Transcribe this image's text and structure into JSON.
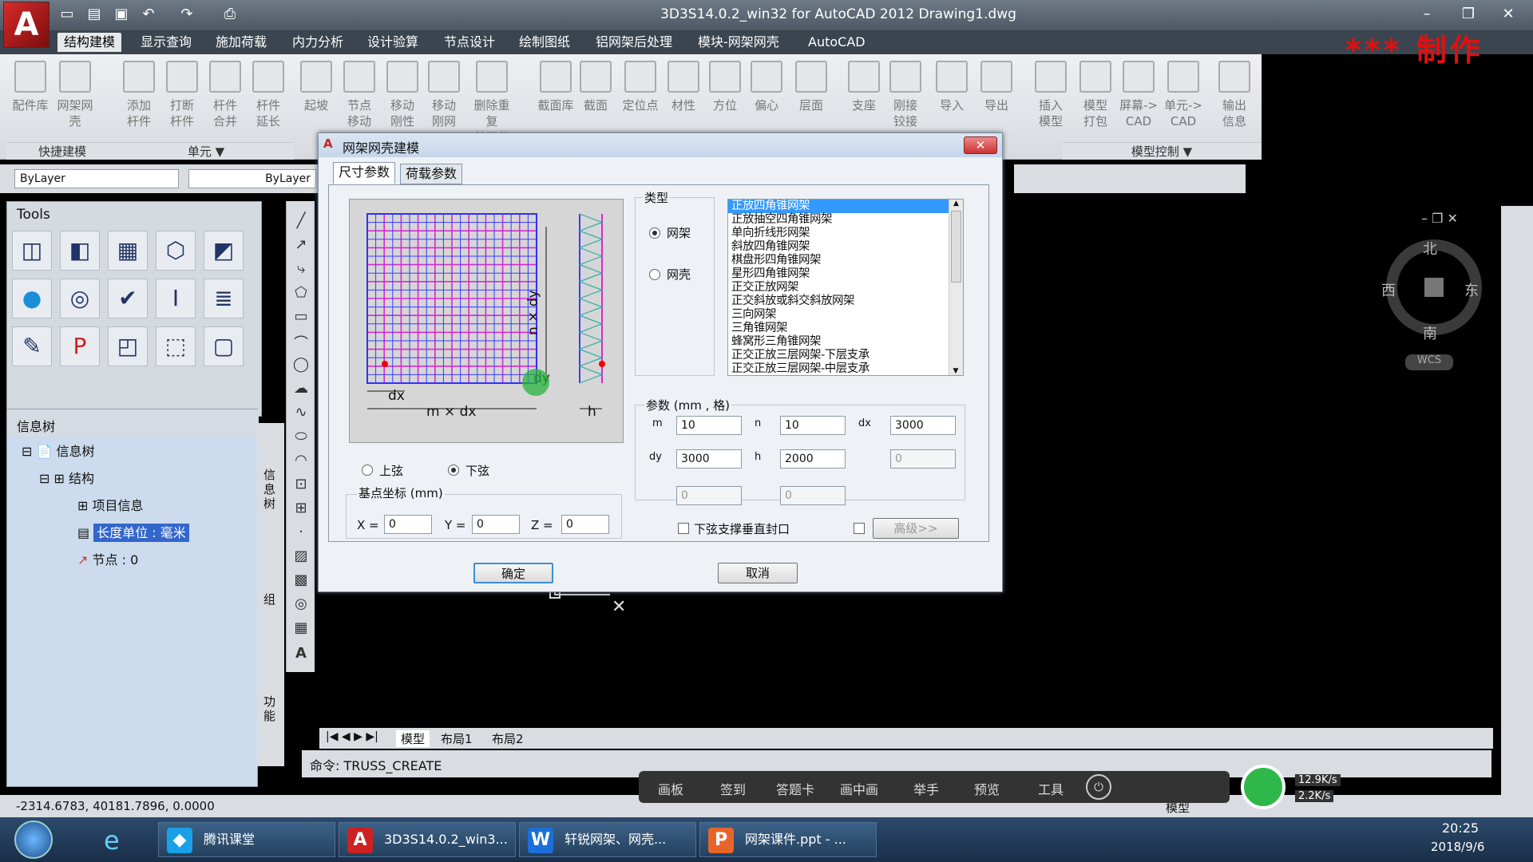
{
  "window": {
    "title": "3D3S14.0.2_win32 for AutoCAD 2012    Drawing1.dwg",
    "maker_text": "*** 制作"
  },
  "menu": [
    "结构建模",
    "显示查询",
    "施加荷载",
    "内力分析",
    "设计验算",
    "节点设计",
    "绘制图纸",
    "铝网架后处理",
    "模块-网架网壳",
    "AutoCAD"
  ],
  "ribbon": {
    "buttons": [
      "配件库",
      "网架网壳",
      "添加\n杆件",
      "打断\n杆件",
      "杆件\n合并",
      "杆件\n延长",
      "起坡",
      "节点\n移动",
      "移动\n刚性",
      "移动\n刚网",
      "删除重复\n单元节点",
      "截面库",
      "截面",
      "定位点",
      "材性",
      "方位",
      "偏心",
      "层面",
      "支座",
      "刚接\n铰接",
      "导入",
      "导出",
      "插入\n模型",
      "模型\n打包",
      "屏幕->\nCAD",
      "单元->\nCAD",
      "输出\n信息"
    ],
    "groups": [
      "快捷建模",
      "单元 ▼",
      "模型控制 ▼"
    ]
  },
  "layer": {
    "combo1": "ByLayer",
    "combo2": "ByLayer"
  },
  "tools_title": "Tools",
  "info_panel": {
    "title": "信息树",
    "tree": [
      "信息树",
      "结构",
      "项目信息",
      "长度单位 : 毫米",
      "节点 :  0"
    ]
  },
  "side_tabs": [
    "信息树",
    "组",
    "功能"
  ],
  "compass": {
    "n": "北",
    "s": "南",
    "e": "东",
    "w": "西",
    "wcs": "WCS"
  },
  "layout_tabs": [
    "模型",
    "布局1",
    "布局2"
  ],
  "command": "命令:  TRUSS_CREATE",
  "status": {
    "coords": "-2314.6783,   40181.7896,  0.0000",
    "mode": "模型"
  },
  "popbar": [
    "画板",
    "签到",
    "答题卡",
    "画中画",
    "举手",
    "预览",
    "工具"
  ],
  "net": {
    "up": "12.9K/s",
    "down": "2.2K/s"
  },
  "taskbar": {
    "tasks": [
      "腾讯课堂",
      "3D3S14.0.2_win3...",
      "轩锐网架、网壳...",
      "网架课件.ppt - ..."
    ],
    "time": "20:25",
    "date": "2018/9/6"
  },
  "dialog": {
    "title": "网架网壳建模",
    "tabs": [
      "尺寸参数",
      "荷载参数"
    ],
    "preview_labels": {
      "ndy": "n × dy",
      "dy": "dy",
      "dx": "dx",
      "mdx": "m × dx",
      "h": "h"
    },
    "chord": {
      "top": "上弦",
      "bottom": "下弦"
    },
    "base_title": "基点坐标 (mm)",
    "base": {
      "x_label": "X =",
      "x": "0",
      "y_label": "Y =",
      "y": "0",
      "z_label": "Z =",
      "z": "0"
    },
    "type_title": "类型",
    "type_options": [
      "网架",
      "网壳"
    ],
    "type_list": [
      "正放四角锥网架",
      "正放抽空四角锥网架",
      "单向折线形网架",
      "斜放四角锥网架",
      "棋盘形四角锥网架",
      "星形四角锥网架",
      "正交正放网架",
      "正交斜放或斜交斜放网架",
      "三向网架",
      "三角锥网架",
      "蜂窝形三角锥网架",
      "正交正放三层网架-下层支承",
      "正交正放三层网架-中层支承"
    ],
    "params_title": "参数 (mm , 格)",
    "params": {
      "m_label": "m",
      "m": "10",
      "n_label": "n",
      "n": "10",
      "dx_label": "dx",
      "dx": "3000",
      "dy_label": "dy",
      "dy": "3000",
      "h_label": "h",
      "h": "2000",
      "extra1": "0",
      "extra2": "0",
      "extra3": "0"
    },
    "checkbox_label": "下弦支撑垂直封口",
    "advanced": "高级>>",
    "ok": "确定",
    "cancel": "取消"
  },
  "colors": {
    "grid_line": "#d52bd0",
    "grid_line2": "#3a3aff",
    "selection": "#3399ff"
  }
}
